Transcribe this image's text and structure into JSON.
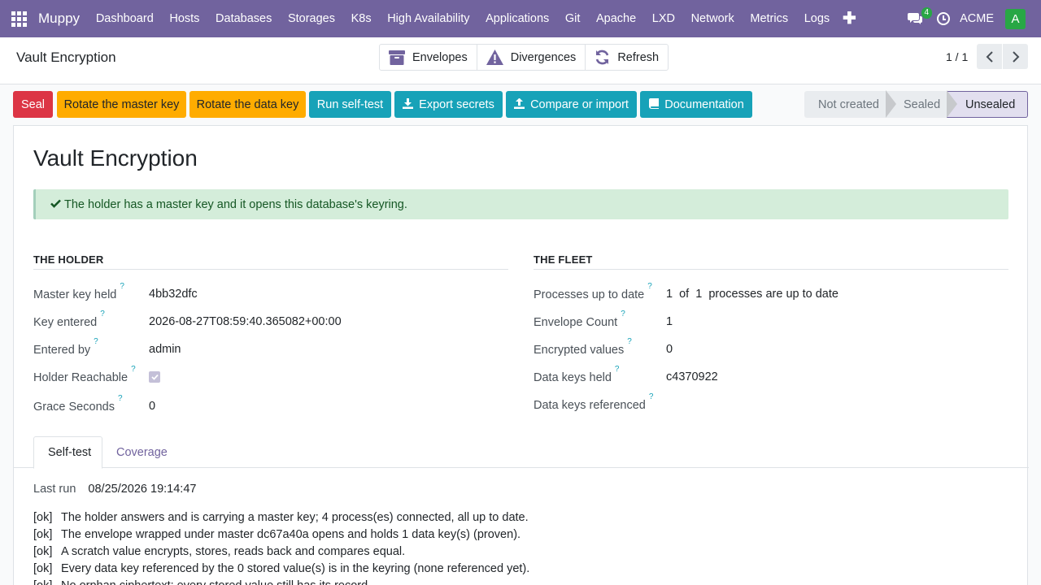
{
  "topnav": {
    "brand": "Muppy",
    "menu": [
      "Dashboard",
      "Hosts",
      "Databases",
      "Storages",
      "K8s",
      "High Availability",
      "Applications",
      "Git",
      "Apache",
      "LXD",
      "Network",
      "Metrics",
      "Logs"
    ],
    "chat_count": "4",
    "company": "ACME",
    "avatar_letter": "A",
    "color": "#71639e"
  },
  "control_panel": {
    "title": "Vault Encryption",
    "buttons": [
      "Envelopes",
      "Divergences",
      "Refresh"
    ],
    "pager": "1 / 1"
  },
  "actions": {
    "seal": "Seal",
    "rotate_master": "Rotate the master key",
    "rotate_data": "Rotate the data key",
    "self_test": "Run self-test",
    "export": "Export secrets",
    "compare": "Compare or import",
    "docs": "Documentation"
  },
  "statusbar": {
    "stages": [
      "Not created",
      "Sealed",
      "Unsealed"
    ],
    "current": "Unsealed"
  },
  "sheet": {
    "title": "Vault Encryption",
    "alert": "The holder has a master key and it opens this database's keyring.",
    "holder": {
      "title": "THE HOLDER",
      "fields": [
        {
          "label": "Master key held",
          "value": "4bb32dfc"
        },
        {
          "label": "Key entered",
          "value": "2026-08-27T08:59:40.365082+00:00"
        },
        {
          "label": "Entered by",
          "value": "admin"
        },
        {
          "label": "Holder Reachable",
          "value": true
        },
        {
          "label": "Grace Seconds",
          "value": "0"
        }
      ]
    },
    "fleet": {
      "title": "THE FLEET",
      "processes": {
        "label": "Processes up to date",
        "up": "1",
        "of": "of",
        "total": "1",
        "suffix": "processes are up to date"
      },
      "fields": [
        {
          "label": "Envelope Count",
          "value": "1"
        },
        {
          "label": "Encrypted values",
          "value": "0"
        },
        {
          "label": "Data keys held",
          "value": "c4370922"
        },
        {
          "label": "Data keys referenced",
          "value": ""
        }
      ]
    },
    "tabs": [
      "Self-test",
      "Coverage"
    ],
    "last_run_label": "Last run",
    "last_run_value": "08/25/2026 19:14:47",
    "log": [
      {
        "tag": "[ok]",
        "text": "The holder answers and is carrying a master key; 4 process(es) connected, all up to date."
      },
      {
        "tag": "[ok]",
        "text": "The envelope wrapped under master dc67a40a opens and holds 1 data key(s) (proven)."
      },
      {
        "tag": "[ok]",
        "text": "A scratch value encrypts, stores, reads back and compares equal."
      },
      {
        "tag": "[ok]",
        "text": "Every data key referenced by the 0 stored value(s) is in the keyring (none referenced yet)."
      },
      {
        "tag": "[ok]",
        "text": "No orphan ciphertext: every stored value still has its record."
      }
    ]
  }
}
